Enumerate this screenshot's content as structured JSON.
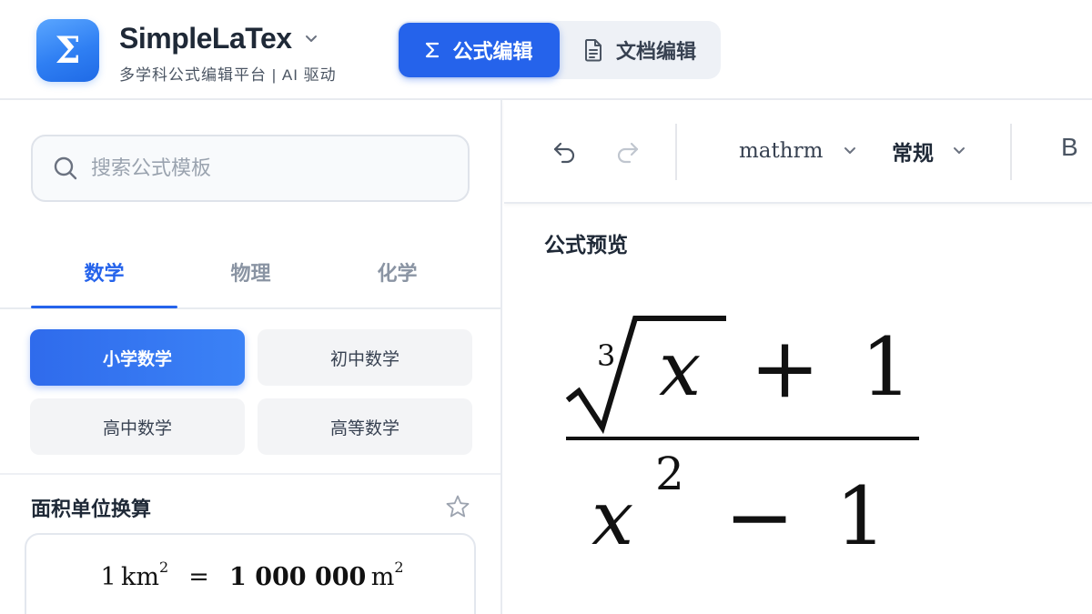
{
  "header": {
    "logo_symbol": "Σ",
    "brand_name": "SimpleLaTex",
    "brand_subtitle": "多学科公式编辑平台 | AI 驱动",
    "modes": [
      {
        "label": "公式编辑",
        "icon": "sigma-icon",
        "active": true
      },
      {
        "label": "文档编辑",
        "icon": "document-icon",
        "active": false
      }
    ]
  },
  "sidebar": {
    "search": {
      "placeholder": "搜索公式模板",
      "value": ""
    },
    "tabs": [
      {
        "label": "数学",
        "active": true
      },
      {
        "label": "物理",
        "active": false
      },
      {
        "label": "化学",
        "active": false
      }
    ],
    "categories": [
      {
        "label": "小学数学",
        "active": true
      },
      {
        "label": "初中数学",
        "active": false
      },
      {
        "label": "高中数学",
        "active": false
      },
      {
        "label": "高等数学",
        "active": false
      }
    ],
    "template": {
      "title": "面积单位换算",
      "formula": {
        "lhs_num": "1",
        "lhs_unit": "km",
        "lhs_exp": "2",
        "equals": "=",
        "rhs_num": "1 000 000",
        "rhs_unit": "m",
        "rhs_exp": "2"
      }
    }
  },
  "editor": {
    "toolbar": {
      "font_select": "mathrm",
      "style_select": "常规",
      "bold_label": "B"
    },
    "preview_label": "公式预览",
    "formula": {
      "index": "3",
      "radicand": "x",
      "plus": "+",
      "num_const": "1",
      "den_var": "x",
      "den_exp": "2",
      "minus": "−",
      "den_const": "1"
    }
  },
  "colors": {
    "accent": "#2563eb",
    "logo_gradient_start": "#5aa6ff",
    "logo_gradient_end": "#1f6ae6",
    "muted_text": "#8a94a3"
  }
}
